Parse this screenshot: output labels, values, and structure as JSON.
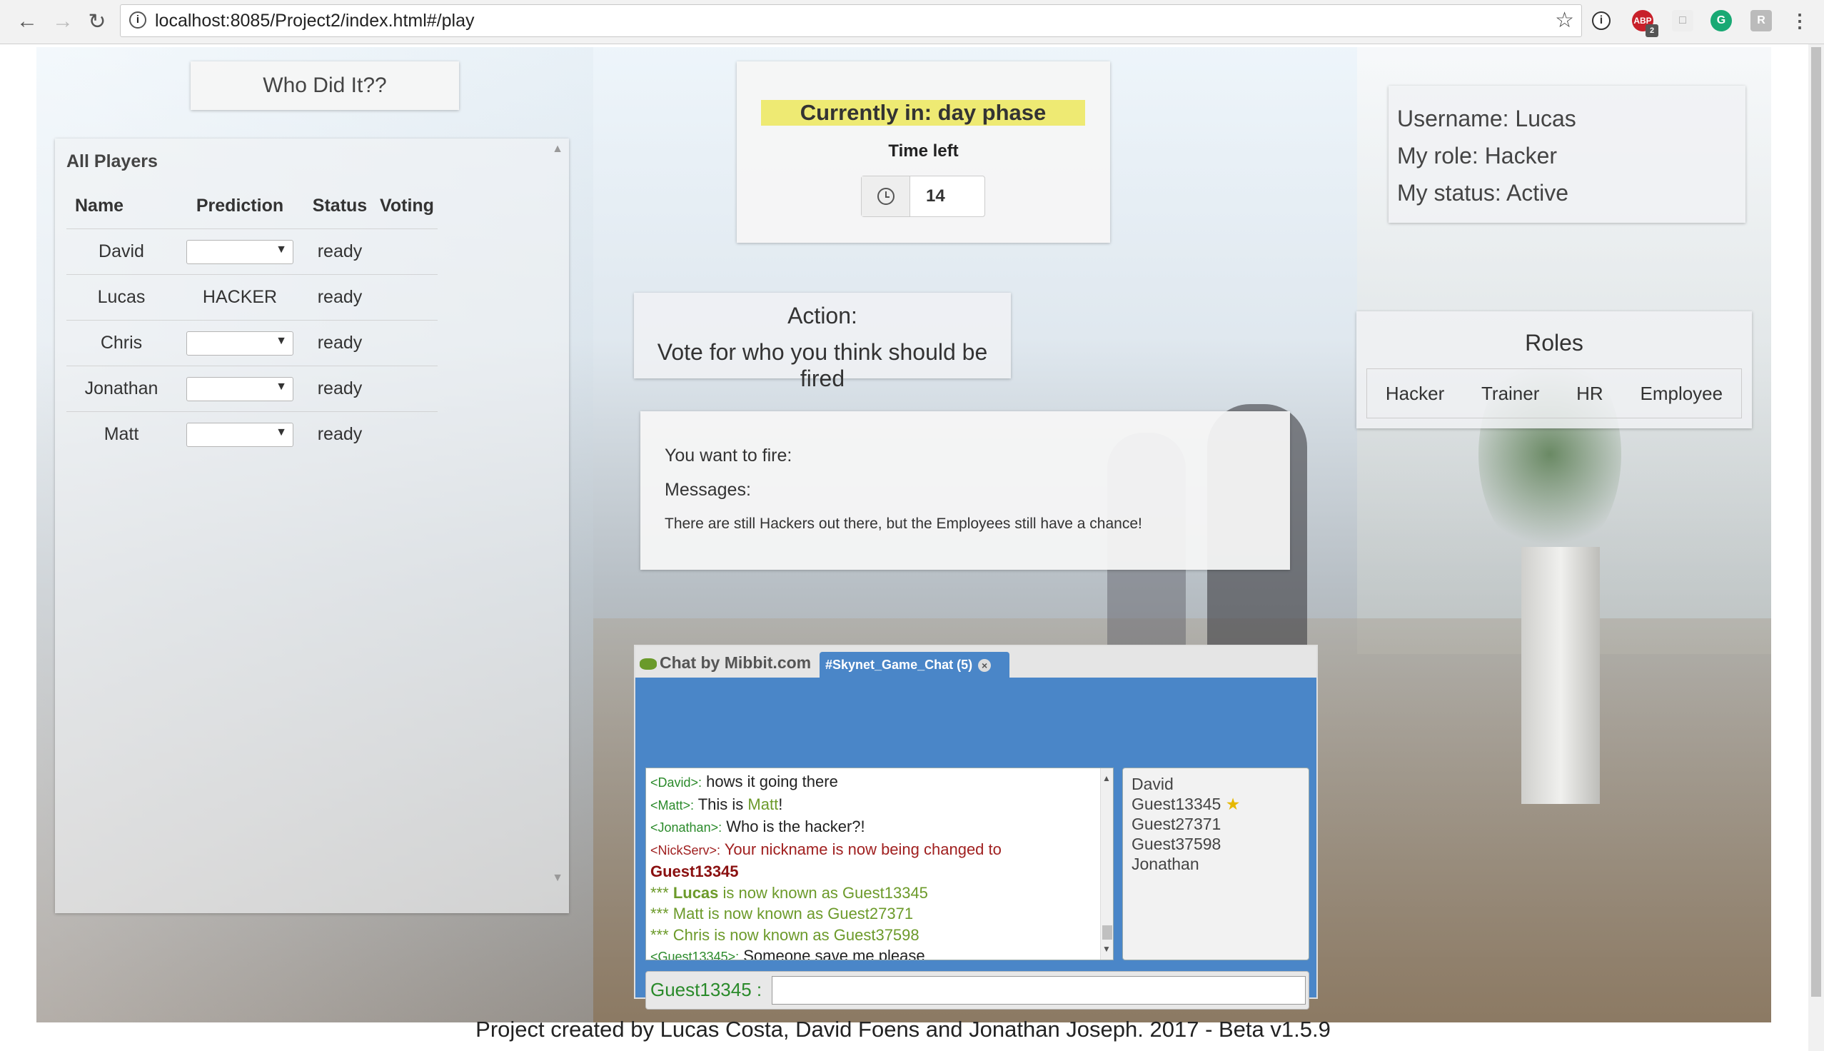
{
  "browser": {
    "url": "localhost:8085/Project2/index.html#/play",
    "ext_badge": "2"
  },
  "title": "Who Did It??",
  "players": {
    "heading": "All Players",
    "columns": [
      "Name",
      "Prediction",
      "Status",
      "Voting"
    ],
    "rows": [
      {
        "name": "David",
        "prediction": "",
        "status": "ready"
      },
      {
        "name": "Lucas",
        "prediction": "HACKER",
        "status": "ready"
      },
      {
        "name": "Chris",
        "prediction": "",
        "status": "ready"
      },
      {
        "name": "Jonathan",
        "prediction": "",
        "status": "ready"
      },
      {
        "name": "Matt",
        "prediction": "",
        "status": "ready"
      }
    ]
  },
  "phase": {
    "banner": "Currently in: day phase",
    "time_left_label": "Time left",
    "time_left_value": "14"
  },
  "user": {
    "username": "Username: Lucas",
    "role": "My role: Hacker",
    "status": "My status: Active"
  },
  "action": {
    "title": "Action:",
    "text": "Vote for who you think should be fired"
  },
  "roles": {
    "heading": "Roles",
    "items": [
      "Hacker",
      "Trainer",
      "HR",
      "Employee"
    ]
  },
  "messages": {
    "fire_label": "You want to fire:",
    "messages_label": "Messages:",
    "message": "There are still Hackers out there, but the Employees still have a chance!"
  },
  "chat": {
    "brand": "Chat by Mibbit.com",
    "tab": "#Skynet_Game_Chat (5)",
    "log": [
      {
        "nick": "<David>:",
        "text": " hows it going there"
      },
      {
        "nick": "<Matt>:",
        "text": " This is ",
        "extra": "Matt",
        "tail": "!"
      },
      {
        "nick": "<Jonathan>:",
        "text": " Who is the hacker?!"
      },
      {
        "nick": "<NickServ>:",
        "text": " Your nickname is now being changed to"
      },
      {
        "text": "Guest13345"
      },
      {
        "prefix": "***",
        "bold": "Lucas",
        "text": " is now known as Guest13345"
      },
      {
        "text": "*** Matt is now known as Guest27371"
      },
      {
        "text": "*** Chris is now known as Guest37598"
      },
      {
        "nick": "<Guest13345>:",
        "text": " Someone save me please"
      }
    ],
    "users": [
      "David",
      "Guest13345",
      "Guest27371",
      "Guest37598",
      "Jonathan"
    ],
    "input_nick": "Guest13345 :",
    "input_value": ""
  },
  "footer": "Project created by Lucas Costa, David Foens and Jonathan Joseph. 2017 - Beta v1.5.9"
}
